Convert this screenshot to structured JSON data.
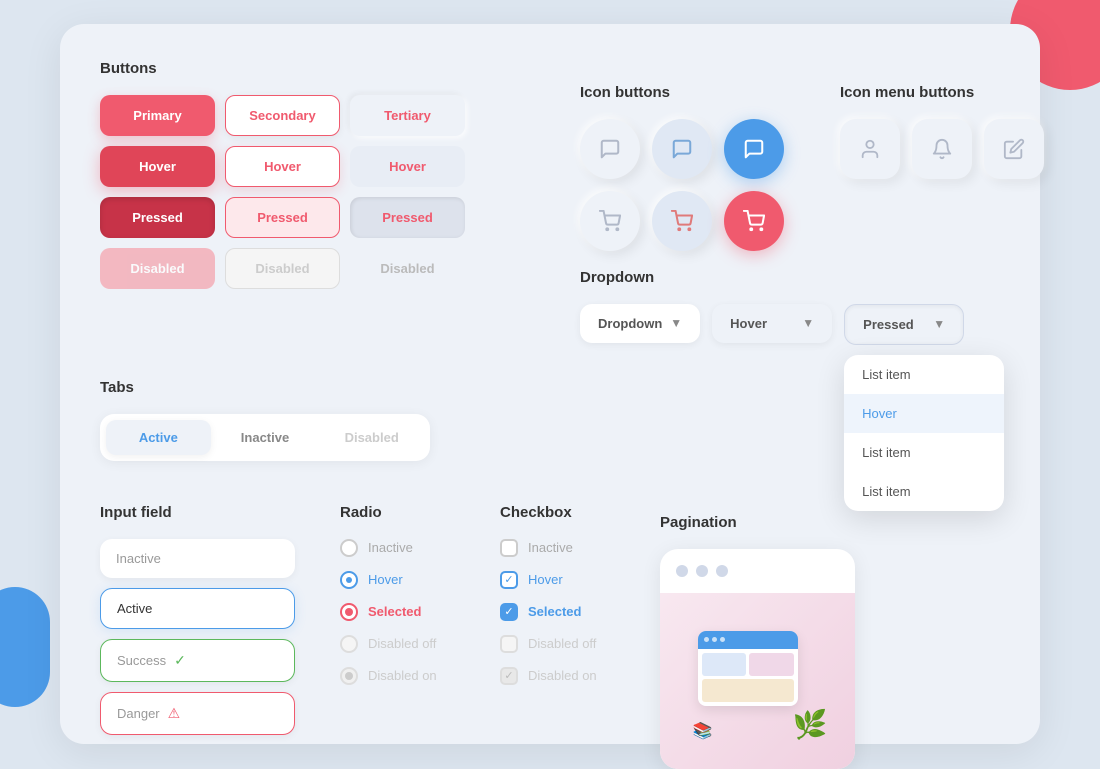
{
  "page": {
    "background": "#dde6f0"
  },
  "buttons": {
    "section_title": "Buttons",
    "rows": [
      [
        "Primary",
        "Secondary",
        "Tertiary"
      ],
      [
        "Hover",
        "Hover",
        "Hover"
      ],
      [
        "Pressed",
        "Pressed",
        "Pressed"
      ],
      [
        "Disabled",
        "Disabled",
        "Disabled"
      ]
    ]
  },
  "tabs": {
    "section_title": "Tabs",
    "items": [
      "Active",
      "Inactive",
      "Disabled"
    ]
  },
  "icon_buttons": {
    "section_title": "Icon buttons"
  },
  "icon_menu_buttons": {
    "section_title": "Icon menu buttons"
  },
  "dropdown": {
    "section_title": "Dropdown",
    "buttons": [
      "Dropdown",
      "Hover",
      "Pressed"
    ],
    "menu_items": [
      "List item",
      "Hover",
      "List item",
      "List item"
    ]
  },
  "input_field": {
    "section_title": "Input field",
    "fields": [
      {
        "label": "Inactive",
        "state": "inactive"
      },
      {
        "label": "Active",
        "state": "active"
      },
      {
        "label": "Success",
        "state": "success"
      },
      {
        "label": "Danger",
        "state": "danger"
      }
    ]
  },
  "radio": {
    "section_title": "Radio",
    "items": [
      {
        "label": "Inactive",
        "state": "inactive"
      },
      {
        "label": "Hover",
        "state": "hover"
      },
      {
        "label": "Selected",
        "state": "selected"
      },
      {
        "label": "Disabled off",
        "state": "disabled-off"
      },
      {
        "label": "Disabled on",
        "state": "disabled-on"
      }
    ]
  },
  "checkbox": {
    "section_title": "Checkbox",
    "items": [
      {
        "label": "Inactive",
        "state": "inactive"
      },
      {
        "label": "Hover",
        "state": "hover"
      },
      {
        "label": "Selected",
        "state": "selected"
      },
      {
        "label": "Disabled off",
        "state": "disabled-off"
      },
      {
        "label": "Disabled on",
        "state": "disabled-on"
      }
    ]
  },
  "pagination": {
    "section_title": "Pagination"
  }
}
